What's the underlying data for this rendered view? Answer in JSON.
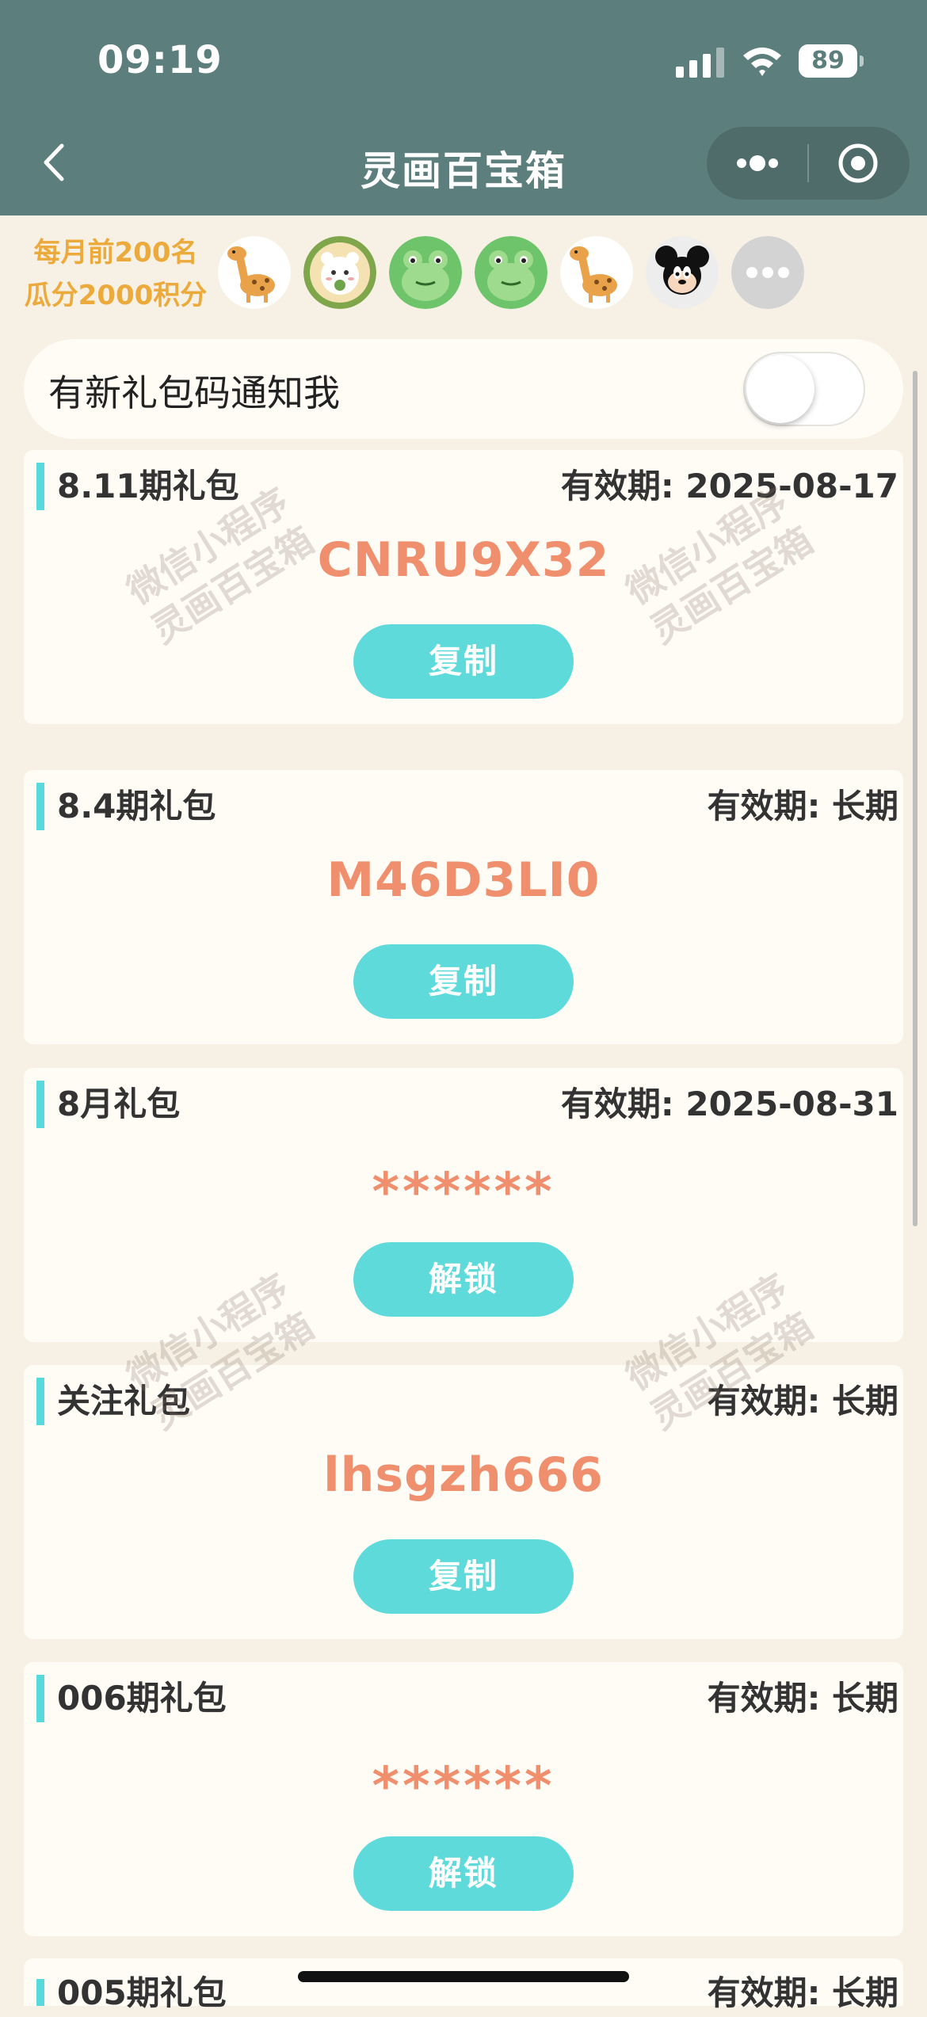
{
  "status_bar": {
    "time": "09:19",
    "battery": "89"
  },
  "nav": {
    "title": "灵画百宝箱"
  },
  "banner": {
    "line1": "每月前200名",
    "line2": "瓜分2000积分",
    "avatars": [
      "giraffe",
      "bear",
      "frog",
      "frog",
      "giraffe",
      "mickey",
      "more"
    ]
  },
  "notify": {
    "label": "有新礼包码通知我",
    "enabled": false
  },
  "cards": [
    {
      "title": "8.11期礼包",
      "expiry": "有效期: 2025-08-17",
      "code": "CNRU9X32",
      "action": "复制"
    },
    {
      "title": "8.4期礼包",
      "expiry": "有效期: 长期",
      "code": "M46D3LI0",
      "action": "复制"
    },
    {
      "title": "8月礼包",
      "expiry": "有效期: 2025-08-31",
      "code": "******",
      "action": "解锁"
    },
    {
      "title": "关注礼包",
      "expiry": "有效期: 长期",
      "code": "lhsgzh666",
      "action": "复制"
    },
    {
      "title": "006期礼包",
      "expiry": "有效期: 长期",
      "code": "******",
      "action": "解锁"
    },
    {
      "title": "005期礼包",
      "expiry": "有效期: 长期"
    }
  ],
  "watermark": {
    "line1": "微信小程序",
    "line2": "灵画百宝箱"
  },
  "colors": {
    "header_bg": "#5C7E7C",
    "page_bg": "#F7F1E5",
    "card_bg": "#FFFCF6",
    "accent_cyan": "#5EDADB",
    "code_orange": "#F08F6E",
    "banner_orange": "#EBAA3B"
  }
}
